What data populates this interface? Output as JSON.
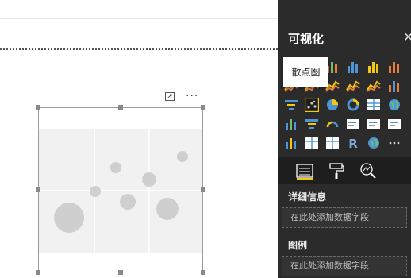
{
  "panel": {
    "title": "可视化",
    "tooltip": "散点图",
    "icons": [
      "table-icon",
      "stacked-bar-icon",
      "clustered-column-icon",
      "stacked-column-icon",
      "column-chart-icon",
      "100-column-icon",
      "line-chart-icon",
      "area-chart-icon",
      "ribbon-chart-icon",
      "line-column-icon",
      "line-clustered-icon",
      "waterfall-icon",
      "funnel-icon",
      "scatter-chart-icon",
      "pie-chart-icon",
      "donut-chart-icon",
      "treemap-icon",
      "map-icon",
      "filled-map-icon",
      "funnel-filter-icon",
      "gauge-icon",
      "card-icon",
      "multirow-card-icon",
      "kpi-icon",
      "slicer-icon",
      "table-visual-icon",
      "matrix-icon",
      "r-visual-icon",
      "globe-icon",
      "more-visuals-icon"
    ],
    "fields_title": "详细信息",
    "fields_placeholder": "在此处添加数据字段",
    "legend_title": "图例",
    "legend_placeholder": "在此处添加数据字段",
    "accent": "#f2c811"
  }
}
